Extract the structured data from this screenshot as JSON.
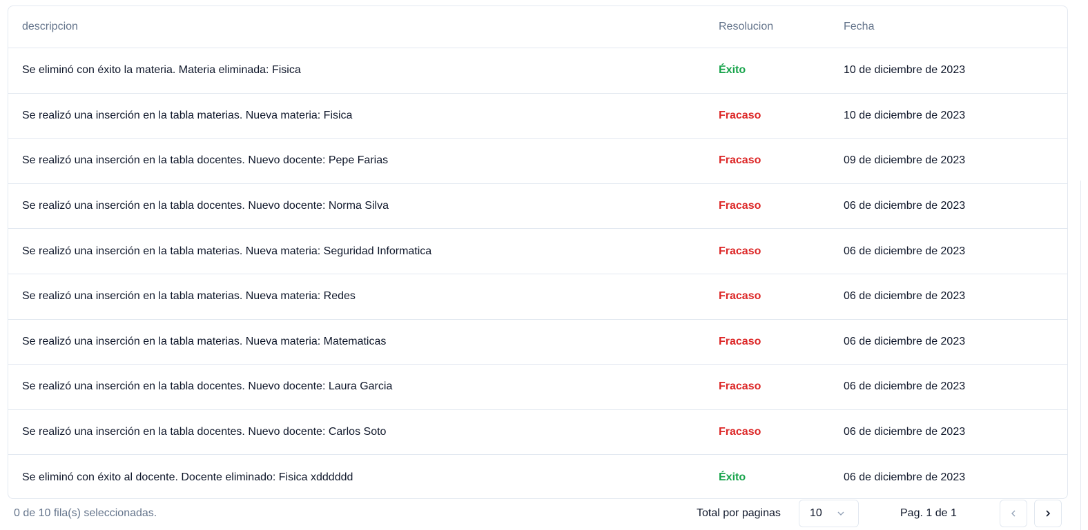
{
  "table": {
    "headers": [
      "descripcion",
      "Resolucion",
      "Fecha"
    ],
    "rows": [
      {
        "descripcion": "Se eliminó con éxito la materia. Materia eliminada: Fisica",
        "resolucion": "Éxito",
        "fecha": "10 de diciembre de 2023"
      },
      {
        "descripcion": "Se realizó una inserción en la tabla materias. Nueva materia: Fisica",
        "resolucion": "Fracaso",
        "fecha": "10 de diciembre de 2023"
      },
      {
        "descripcion": "Se realizó una inserción en la tabla docentes. Nuevo docente: Pepe Farias",
        "resolucion": "Fracaso",
        "fecha": "09 de diciembre de 2023"
      },
      {
        "descripcion": "Se realizó una inserción en la tabla docentes. Nuevo docente: Norma Silva",
        "resolucion": "Fracaso",
        "fecha": "06 de diciembre de 2023"
      },
      {
        "descripcion": "Se realizó una inserción en la tabla materias. Nueva materia: Seguridad Informatica",
        "resolucion": "Fracaso",
        "fecha": "06 de diciembre de 2023"
      },
      {
        "descripcion": "Se realizó una inserción en la tabla materias. Nueva materia: Redes",
        "resolucion": "Fracaso",
        "fecha": "06 de diciembre de 2023"
      },
      {
        "descripcion": "Se realizó una inserción en la tabla materias. Nueva materia: Matematicas",
        "resolucion": "Fracaso",
        "fecha": "06 de diciembre de 2023"
      },
      {
        "descripcion": "Se realizó una inserción en la tabla docentes. Nuevo docente: Laura Garcia",
        "resolucion": "Fracaso",
        "fecha": "06 de diciembre de 2023"
      },
      {
        "descripcion": "Se realizó una inserción en la tabla docentes. Nuevo docente: Carlos Soto",
        "resolucion": "Fracaso",
        "fecha": "06 de diciembre de 2023"
      },
      {
        "descripcion": "Se eliminó con éxito al docente. Docente eliminado: Fisica xdddddd",
        "resolucion": "Éxito",
        "fecha": "06 de diciembre de 2023"
      }
    ]
  },
  "colors": {
    "success": "#16a34a",
    "failure": "#dc2626"
  },
  "footer": {
    "selected": "0 de 10 fila(s) seleccionadas.",
    "per_page_label": "Total por paginas",
    "per_page_value": "10",
    "page_info": "Pag. 1 de 1",
    "prev_icon": "chevron-left-icon",
    "next_icon": "chevron-right-icon"
  }
}
